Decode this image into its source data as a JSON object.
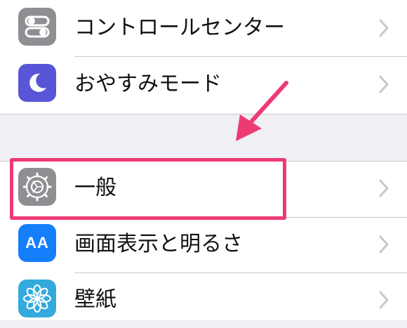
{
  "settings": {
    "group_top": [
      {
        "label": "コントロールセンター",
        "icon": "control-center-icon",
        "icon_color": "#8e8e93"
      },
      {
        "label": "おやすみモード",
        "icon": "moon-icon",
        "icon_color": "#5856d6"
      }
    ],
    "group_bottom": [
      {
        "label": "一般",
        "icon": "gear-icon",
        "icon_color": "#8e8e93"
      },
      {
        "label": "画面表示と明るさ",
        "icon": "display-aa-icon",
        "icon_color": "#147efb",
        "icon_text": "AA"
      },
      {
        "label": "壁紙",
        "icon": "wallpaper-flower-icon",
        "icon_color": "#34aadc"
      }
    ]
  },
  "annotation": {
    "highlight_color": "#ee3a72",
    "arrow_color": "#ee3a72",
    "highlighted_item": "一般"
  }
}
